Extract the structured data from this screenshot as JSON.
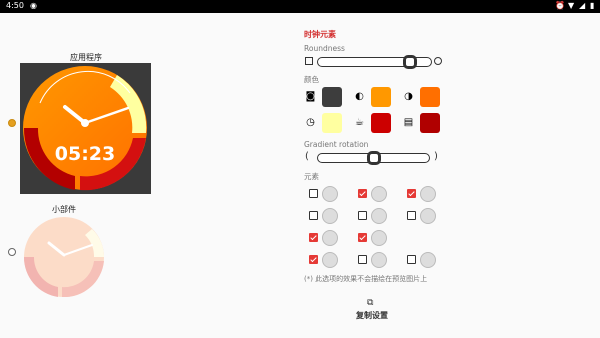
{
  "status": {
    "time": "4:50"
  },
  "left": {
    "app_title": "应用程序",
    "app_time": "05:23",
    "widget_title": "小部件"
  },
  "panel": {
    "title": "时钟元素",
    "roundness_label": "Roundness",
    "roundness_value": 0.85,
    "colors_label": "颜色",
    "colors": [
      "#3d3d3d",
      "#ff9800",
      "#ff6f00",
      "#ffffa0",
      "#cc0000",
      "#b00000"
    ],
    "gradient_label": "Gradient rotation",
    "gradient_value": 0.5,
    "elements_label": "元素",
    "elements_checked": [
      false,
      true,
      true,
      false,
      false,
      false,
      true,
      true,
      true,
      false,
      false
    ],
    "note": "(*) 此选项的效果不会描绘在预览图片上",
    "copy_label": "复制设置",
    "accent": "#e53935"
  }
}
